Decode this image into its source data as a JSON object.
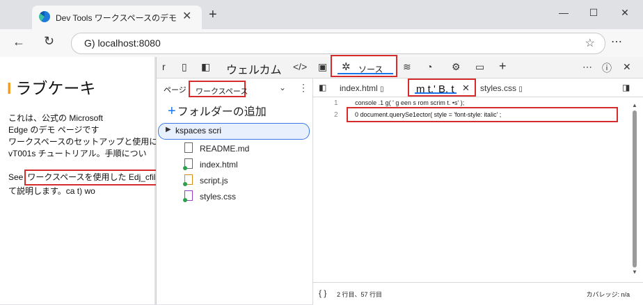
{
  "browser": {
    "tab_title": "Dev Tools ワークスペースのデモ",
    "url": "G) localhost:8080"
  },
  "page": {
    "title_mark": "I",
    "title": "ラブケーキ",
    "para1": [
      "これは、公式の Microsoft",
      "Edge のデモ ページです",
      "ワークスペースのセットアップと使用に関する De",
      "vT001s チュートリアル。手順につい"
    ],
    "para2_prefix": "See",
    "para2_link": "ワークスペースを使用した Edj_cfiles",
    "para2_end": "て説明します。ca t) wo"
  },
  "devtools": {
    "welcome_tab": "ウェルカム",
    "sources_tab": "ソース",
    "navigator": {
      "page_tab": "ページ",
      "workspace_tab": "ワークスペース",
      "add_folder": "フォルダーの追加",
      "folder": "kspaces scri",
      "files": [
        "README.md",
        "index.html",
        "script.js",
        "styles.css"
      ]
    },
    "editor": {
      "tabs": [
        "index.html",
        "m t.' B. t",
        "styles.css"
      ],
      "line_numbers": [
        "1",
        "2"
      ],
      "line1": "console .1        g( ' g een s rom scrim t. •s'                    );",
      "line2": "0 document.querySe1ector( style = 'font-style: italic' ;",
      "status_position": "2 行目、57 行目",
      "status_coverage": "カバレッジ: n/a"
    }
  }
}
